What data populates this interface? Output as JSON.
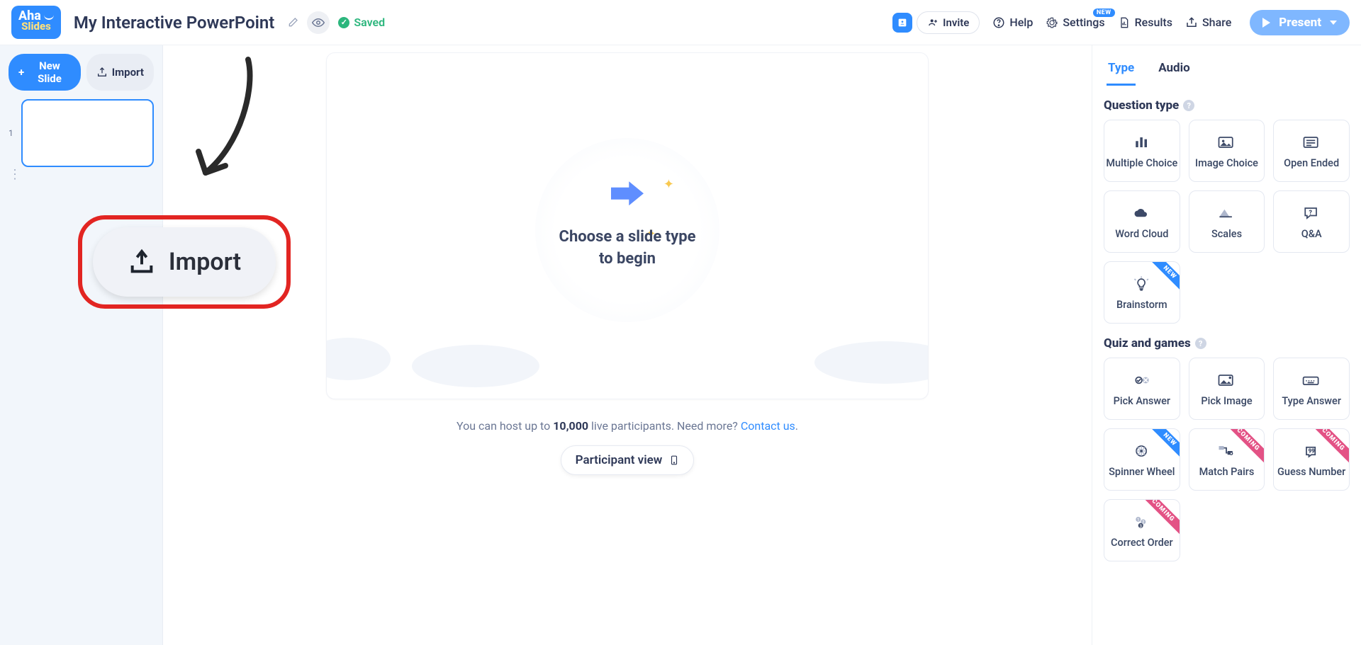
{
  "header": {
    "logo_line1": "Aha",
    "logo_line2": "Slides",
    "title": "My Interactive PowerPoint",
    "saved_label": "Saved",
    "invite_label": "Invite",
    "help_label": "Help",
    "settings_label": "Settings",
    "settings_badge": "NEW",
    "results_label": "Results",
    "share_label": "Share",
    "present_label": "Present"
  },
  "left": {
    "new_slide_label": "New Slide",
    "import_label": "Import",
    "slide_number": "1"
  },
  "canvas": {
    "placeholder_line1": "Choose a slide type",
    "placeholder_line2": "to begin",
    "info_prefix": "You can host up to ",
    "info_bold": "10,000",
    "info_suffix": " live participants. Need more? ",
    "info_link": "Contact us",
    "info_period": ".",
    "participant_view_label": "Participant view"
  },
  "callout": {
    "import_big": "Import"
  },
  "right": {
    "tab_type": "Type",
    "tab_audio": "Audio",
    "sec_question": "Question type",
    "sec_quiz": "Quiz and games",
    "qtypes": [
      {
        "label": "Multiple Choice"
      },
      {
        "label": "Image Choice"
      },
      {
        "label": "Open Ended"
      },
      {
        "label": "Word Cloud"
      },
      {
        "label": "Scales"
      },
      {
        "label": "Q&A"
      },
      {
        "label": "Brainstorm",
        "ribbon": "NEW"
      }
    ],
    "quiz": [
      {
        "label": "Pick Answer"
      },
      {
        "label": "Pick Image"
      },
      {
        "label": "Type Answer"
      },
      {
        "label": "Spinner Wheel",
        "ribbon": "NEW"
      },
      {
        "label": "Match Pairs",
        "ribbon": "COMING"
      },
      {
        "label": "Guess Number",
        "ribbon": "COMING"
      },
      {
        "label": "Correct Order",
        "ribbon": "COMING"
      }
    ]
  }
}
